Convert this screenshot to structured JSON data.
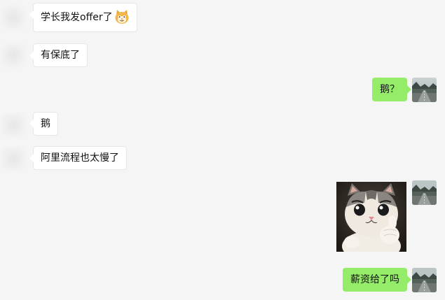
{
  "messages": [
    {
      "side": "left",
      "text": "学长我发offer了",
      "emoji": "cat-face-emoji"
    },
    {
      "side": "left",
      "text": "有保底了"
    },
    {
      "side": "right",
      "text": "鹅？"
    },
    {
      "side": "left",
      "text": "鹅"
    },
    {
      "side": "left",
      "text": "阿里流程也太慢了"
    },
    {
      "side": "right",
      "type": "sticker",
      "sticker": "cat-thumbs-up-sticker"
    },
    {
      "side": "right",
      "text": "薪资给了吗"
    }
  ],
  "colors": {
    "background": "#f5f5f5",
    "incoming_bubble": "#ffffff",
    "outgoing_bubble": "#95ec69"
  }
}
